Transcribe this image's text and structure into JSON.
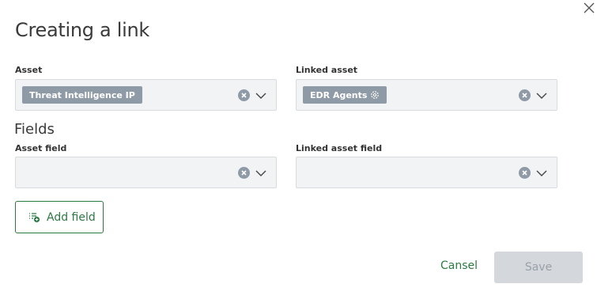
{
  "dialog": {
    "title": "Creating a link",
    "close_icon": "close-icon"
  },
  "asset": {
    "label": "Asset",
    "value_chip": "Threat Intelligence IP"
  },
  "linked_asset": {
    "label": "Linked asset",
    "value_chip": "EDR Agents",
    "chip_icon": "gear-icon"
  },
  "fields": {
    "title": "Fields",
    "asset_field_label": "Asset field",
    "linked_asset_field_label": "Linked asset field"
  },
  "buttons": {
    "add_field": "Add field",
    "add_field_icon": "add-list-icon",
    "cancel": "Cansel",
    "save": "Save"
  },
  "colors": {
    "accent": "#2c7a43",
    "chip": "#8f9aa7",
    "field_bg": "#f2f3f4",
    "disabled_button": "#d4d7db"
  }
}
